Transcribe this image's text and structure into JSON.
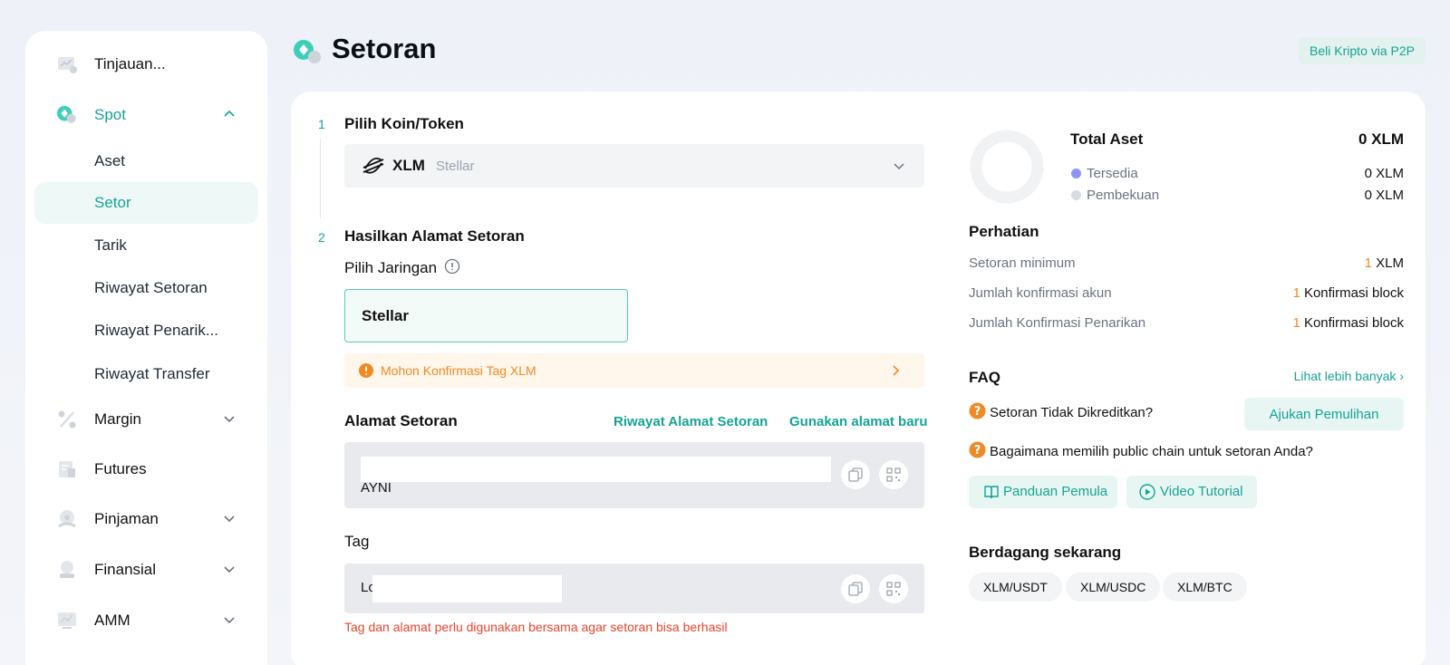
{
  "sidebar": {
    "items": [
      {
        "label": "Tinjauan...",
        "icon": "overview-chart-icon"
      },
      {
        "label": "Spot",
        "icon": "spot-coin-icon"
      },
      {
        "label": "Aset"
      },
      {
        "label": "Setor"
      },
      {
        "label": "Tarik"
      },
      {
        "label": "Riwayat Setoran"
      },
      {
        "label": "Riwayat Penarik..."
      },
      {
        "label": "Riwayat Transfer"
      },
      {
        "label": "Margin",
        "icon": "percent-icon"
      },
      {
        "label": "Futures",
        "icon": "futures-icon"
      },
      {
        "label": "Pinjaman",
        "icon": "loan-icon"
      },
      {
        "label": "Finansial",
        "icon": "finance-icon"
      },
      {
        "label": "AMM",
        "icon": "amm-icon"
      }
    ]
  },
  "header": {
    "title": "Setoran",
    "p2p_button": "Beli Kripto via P2P"
  },
  "step1": {
    "number": "1",
    "title": "Pilih Koin/Token",
    "coin_symbol": "XLM",
    "coin_name": "Stellar"
  },
  "step2": {
    "number": "2",
    "title": "Hasilkan Alamat Setoran",
    "network_label": "Pilih Jaringan",
    "network_value": "Stellar",
    "warning": "Mohon Konfirmasi Tag XLM"
  },
  "address": {
    "label": "Alamat Setoran",
    "history_link": "Riwayat Alamat Setoran",
    "new_link": "Gunakan alamat baru",
    "value_suffix": "AYNI"
  },
  "tag": {
    "label": "Tag",
    "value_prefix": "Lo",
    "note": "Tag dan alamat perlu digunakan bersama agar setoran bisa berhasil"
  },
  "assets": {
    "title": "Total Aset",
    "total": "0 XLM",
    "available_label": "Tersedia",
    "available_value": "0 XLM",
    "frozen_label": "Pembekuan",
    "frozen_value": "0 XLM",
    "available_color": "#8b93f8",
    "frozen_color": "#d8dbe2"
  },
  "notice": {
    "title": "Perhatian",
    "rows": [
      {
        "label": "Setoran minimum",
        "num": "1",
        "unit": " XLM"
      },
      {
        "label": "Jumlah konfirmasi akun",
        "num": "1",
        "unit": " Konfirmasi block"
      },
      {
        "label": "Jumlah Konfirmasi Penarikan",
        "num": "1",
        "unit": " Konfirmasi block"
      }
    ]
  },
  "faq": {
    "title": "FAQ",
    "more_link": "Lihat lebih banyak",
    "q1": "Setoran Tidak Dikreditkan?",
    "q1_button": "Ajukan Pemulihan",
    "q2": "Bagaimana memilih public chain untuk setoran Anda?",
    "guide_button": "Panduan Pemula",
    "video_button": "Video Tutorial"
  },
  "trade": {
    "title": "Berdagang sekarang",
    "pairs": [
      "XLM/USDT",
      "XLM/USDC",
      "XLM/BTC"
    ]
  },
  "colors": {
    "accent": "#16a394",
    "warning": "#f08a24",
    "error": "#e5452f"
  }
}
